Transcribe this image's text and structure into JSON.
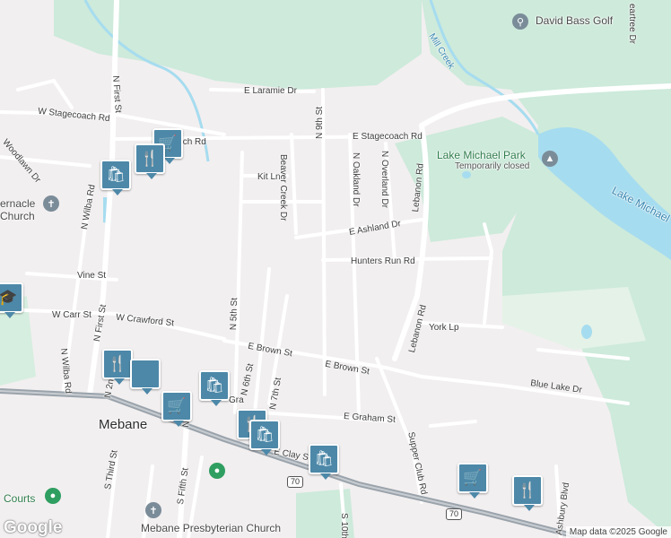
{
  "colors": {
    "background": "#f2eff0",
    "park": "#cdeadb",
    "water": "#a6dcef",
    "road": "#ffffff",
    "highway": "#9aa3ab",
    "pin": "#4d88a8"
  },
  "labels": {
    "e_laramie_dr": "E Laramie Dr",
    "w_stagecoach_rd": "W Stagecoach Rd",
    "e_stagecoach_partial": "E Stagecoach Rd",
    "e_stagecoach_rd": "E Stagecoach Rd",
    "kit_ln": "Kit Ln",
    "n_9th_st": "N 9th St",
    "beaver_creek_dr": "Beaver Creek Dr",
    "n_oakland_dr": "N Oakland Dr",
    "n_overland_dr": "N Overland Dr",
    "e_ashland_dr": "E Ashland Dr",
    "lebanon_rd_upper": "Lebanon Rd",
    "lebanon_rd_lower": "Lebanon Rd",
    "hunters_run_rd": "Hunters Run Rd",
    "york_lp": "York Lp",
    "e_brown_st_left": "E Brown St",
    "e_brown_st_right": "E Brown St",
    "w_carr_st": "W Carr St",
    "w_crawford_st": "W Crawford St",
    "vine_st": "Vine St",
    "n_first_st_top": "N First St",
    "n_first_st_mid": "N First St",
    "n_wilba_rd_top": "N Wilba Rd",
    "n_wilba_rd_mid": "N Wilba Rd",
    "woodlawn_dr": "Woodlawn Dr",
    "tabernacle_church": "ernacle\nChurch",
    "n_5th_st": "N 5th St",
    "n_6th_st": "N 6th St",
    "n_7th_st": "N 7th St",
    "e_graham_st": "E Graham St",
    "graham_partial": "Gra",
    "blue_lake_dr": "Blue Lake Dr",
    "supper_club_rd": "Supper Club Rd",
    "e_clay_st": "E Clay St",
    "s_fifth_st": "S Fifth St",
    "s_third_st": "S Third St",
    "n_2nd": "N 2n",
    "n_5th_lower": "N 5th",
    "s_10th": "S 10th",
    "ashbury_blvd": "Ashbury Blvd",
    "peartree_dr": "eartree Dr",
    "mill_creek": "Mill Creek",
    "lake_michael": "Lake Michael",
    "lake_michael_park": "Lake Michael Park",
    "temporarily_closed": "Temporarily closed",
    "david_bass_golf": "David Bass Golf",
    "mebane": "Mebane",
    "mebane_presbyterian": "Mebane Presbyterian Church",
    "courts": "Courts",
    "hwy_70_a": "70",
    "hwy_70_b": "70"
  },
  "pins": [
    {
      "name": "shopping-cart-icon",
      "glyph": "🛒"
    },
    {
      "name": "restaurant-icon",
      "glyph": "🍴"
    },
    {
      "name": "shopping-bag-icon",
      "glyph": "🛍"
    },
    {
      "name": "graduation-icon",
      "glyph": "🎓"
    },
    {
      "name": "restaurant-icon",
      "glyph": "🍴"
    },
    {
      "name": "shopping-bag-icon",
      "glyph": "🛍"
    },
    {
      "name": "shopping-cart-icon",
      "glyph": "🛒"
    },
    {
      "name": "restaurant-icon",
      "glyph": "🍴"
    },
    {
      "name": "shopping-bag-icon",
      "glyph": "🛍"
    },
    {
      "name": "shopping-bag-icon",
      "glyph": "🛍"
    },
    {
      "name": "shopping-cart-icon",
      "glyph": "🛒"
    },
    {
      "name": "restaurant-icon",
      "glyph": "🍴"
    }
  ],
  "branding": {
    "logo": "Google",
    "attribution": "Map data ©2025 Google"
  }
}
